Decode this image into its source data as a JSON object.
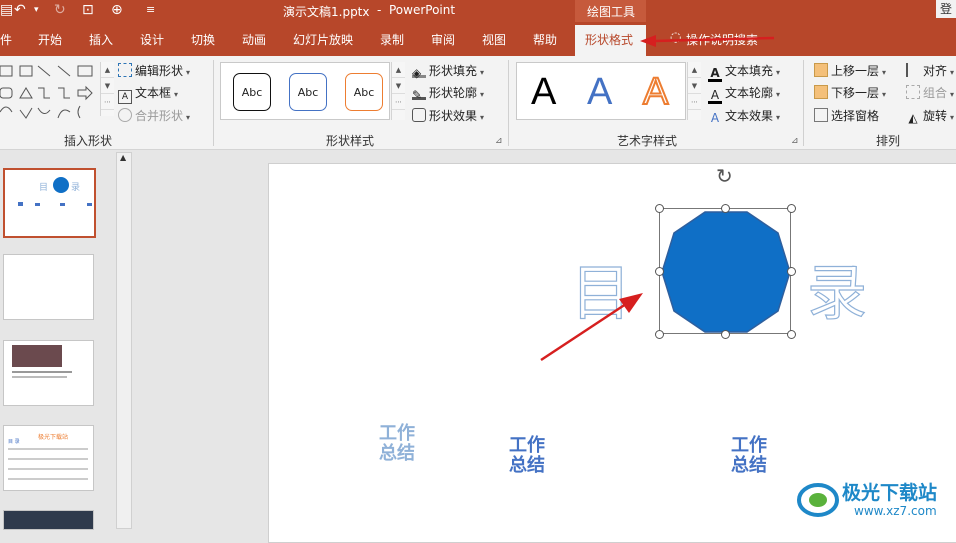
{
  "title": {
    "filename": "演示文稿1.pptx",
    "sep": "-",
    "app": "PowerPoint",
    "context_tool": "绘图工具",
    "signin": "登"
  },
  "tabs": [
    "件",
    "开始",
    "插入",
    "设计",
    "切换",
    "动画",
    "幻灯片放映",
    "录制",
    "审阅",
    "视图",
    "帮助",
    "形状格式"
  ],
  "search": {
    "placeholder": "操作说明搜索"
  },
  "ribbon": {
    "insert_shapes": {
      "title": "插入形状",
      "edit_shape": "编辑形状",
      "text_box": "文本框",
      "merge_shapes": "合并形状"
    },
    "shape_styles": {
      "title": "形状样式",
      "preset_label": "Abc",
      "fill": "形状填充",
      "outline": "形状轮廓",
      "effects": "形状效果"
    },
    "wordart_styles": {
      "title": "艺术字样式",
      "preset_label": "A",
      "text_fill": "文本填充",
      "text_outline": "文本轮廓",
      "text_effects": "文本效果"
    },
    "arrange": {
      "title": "排列",
      "bring_forward": "上移一层",
      "send_backward": "下移一层",
      "selection_pane": "选择窗格",
      "align": "对齐",
      "group": "组合",
      "rotate": "旋转"
    }
  },
  "thumbnails": {
    "slide1": {
      "left": "目",
      "right": "录"
    },
    "slide4": {
      "title": "极光下载站",
      "sub": "目 录"
    }
  },
  "slide": {
    "left_char": "目",
    "right_char": "录",
    "items": [
      "工作\n总结",
      "工作\n总结",
      "工作\n总结"
    ]
  },
  "watermark": {
    "name": "极光下载站",
    "url": "www.xz7.com"
  },
  "colors": {
    "accent": "#b7472a",
    "shape_fill": "#0f6fc6",
    "shape_outline": "#2e5f9e",
    "arrow": "#d61f1f",
    "wordart_blue": "#4472c4",
    "wordart_orange": "#ed7d31"
  }
}
